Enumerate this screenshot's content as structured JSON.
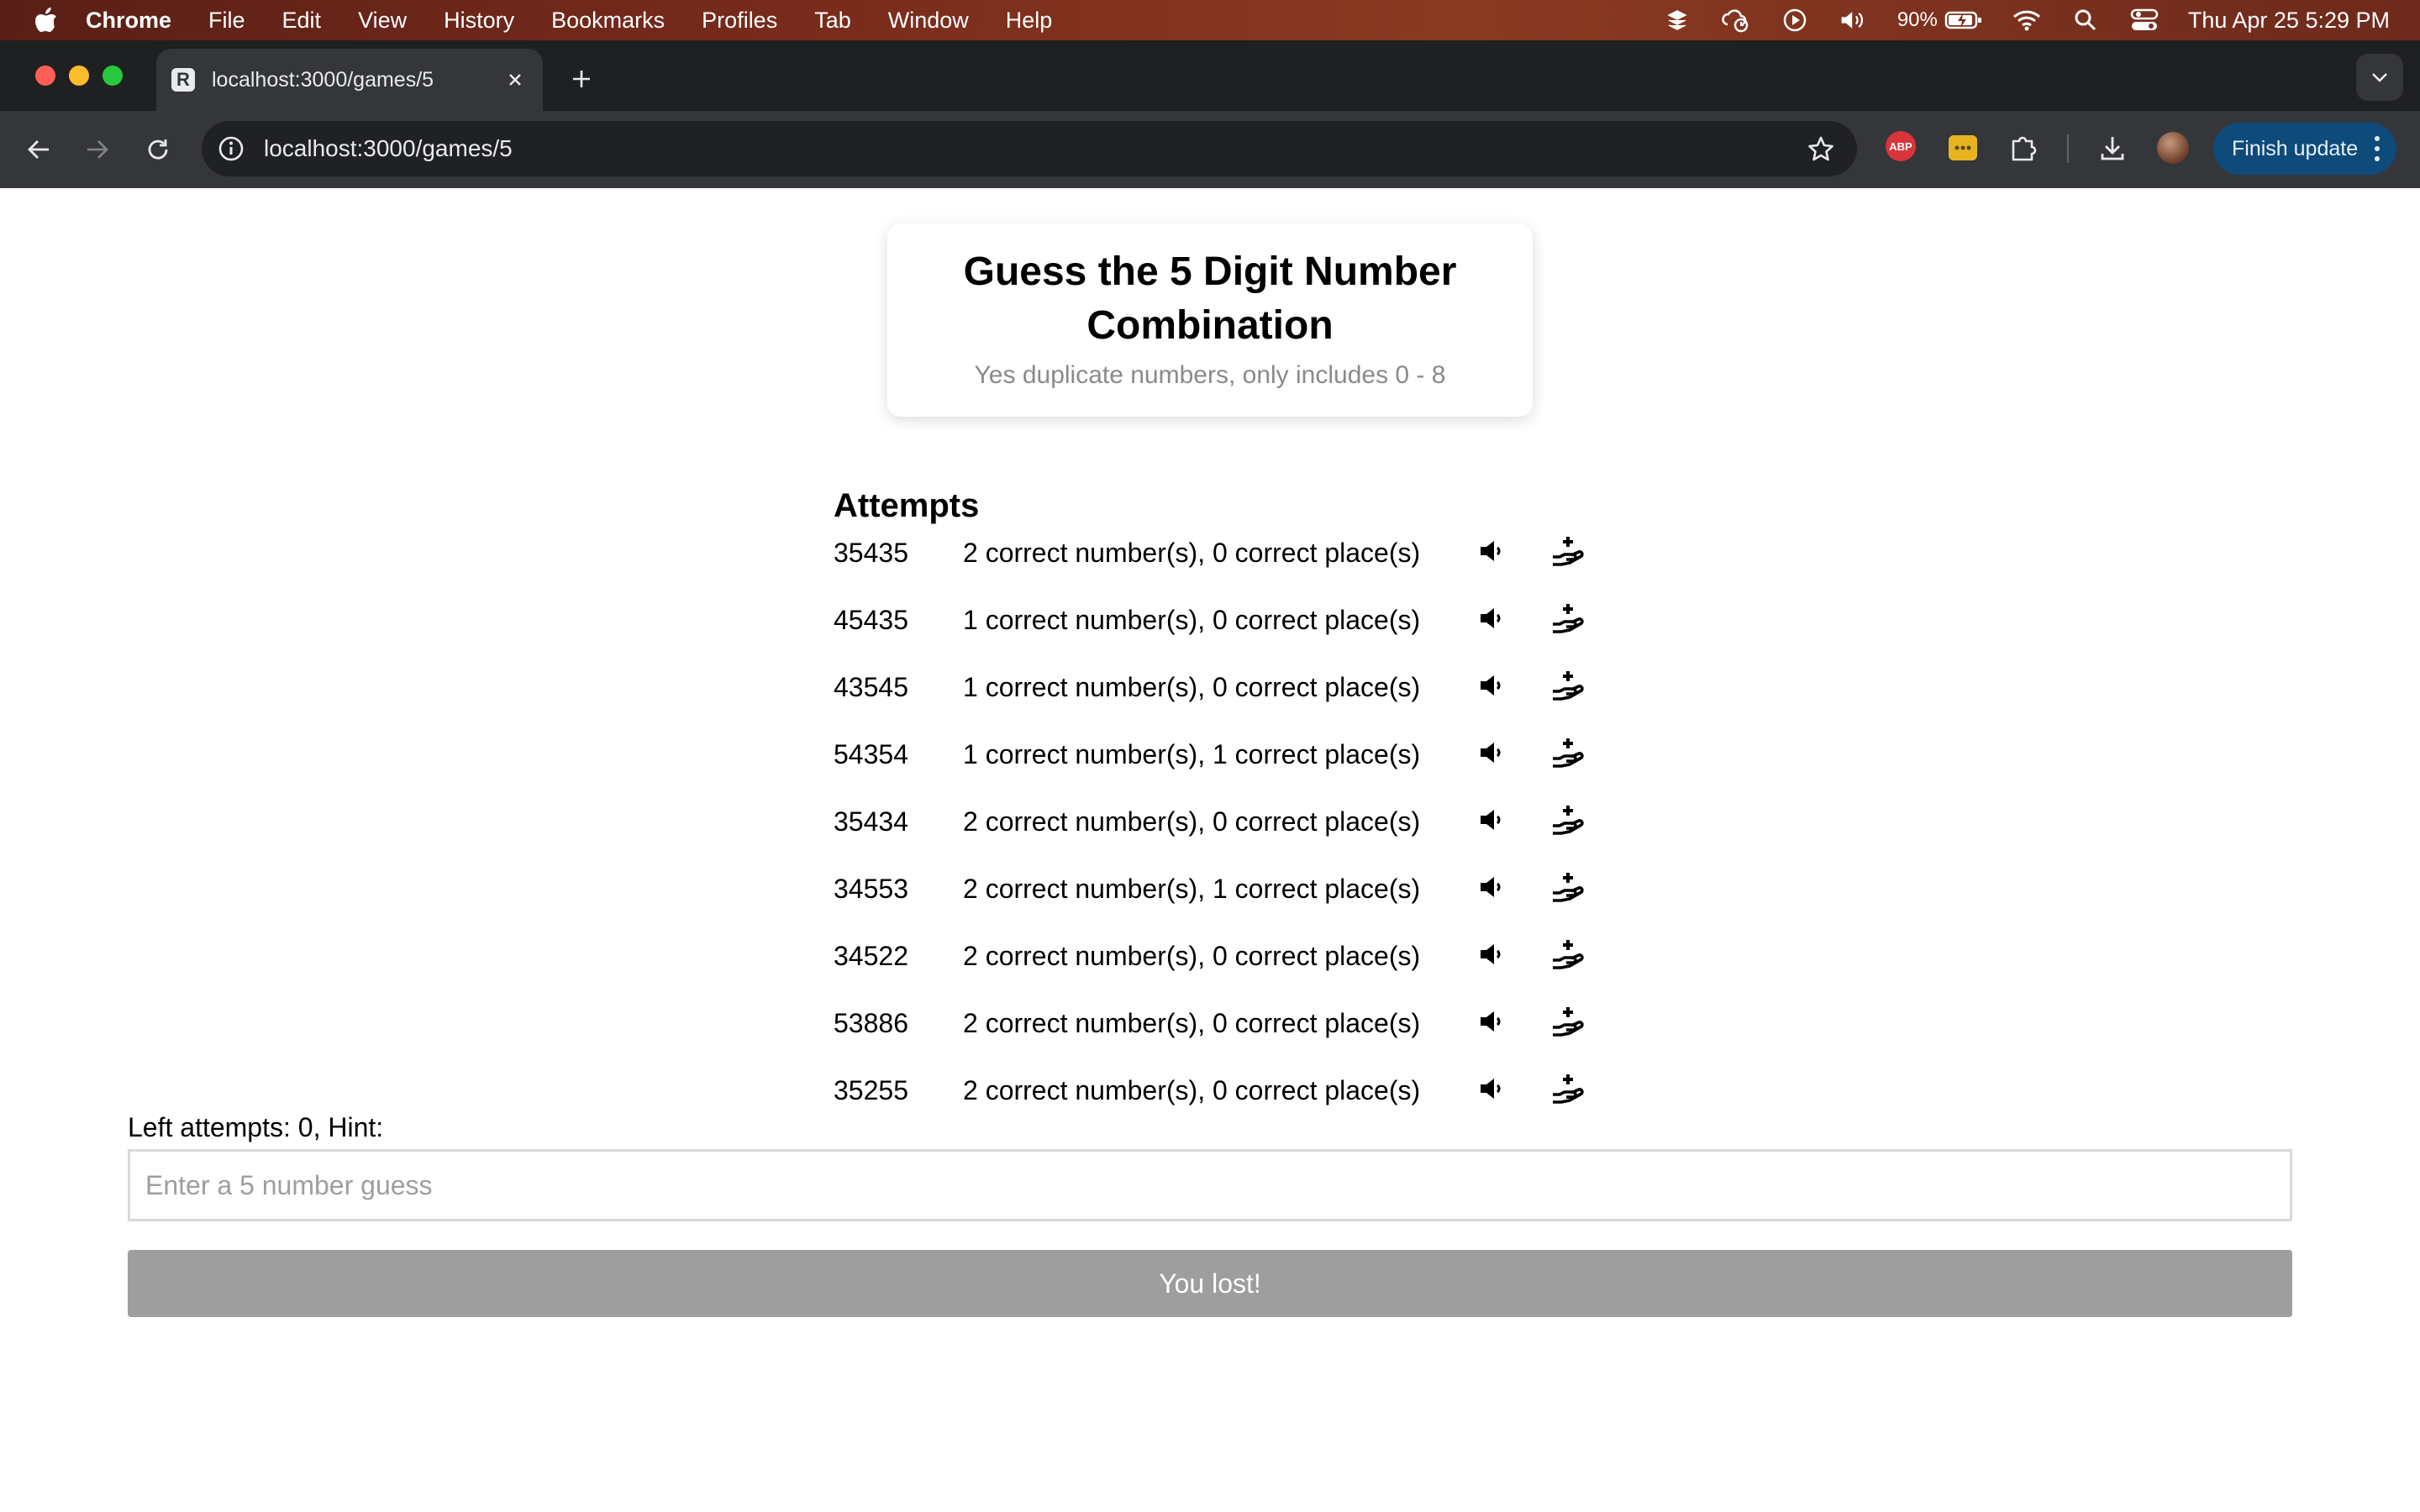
{
  "menubar": {
    "app_name": "Chrome",
    "items": [
      "File",
      "Edit",
      "View",
      "History",
      "Bookmarks",
      "Profiles",
      "Tab",
      "Window",
      "Help"
    ],
    "battery": "90%",
    "clock": "Thu Apr 25  5:29 PM"
  },
  "browser": {
    "tab_title": "localhost:3000/games/5",
    "url": "localhost:3000/games/5",
    "abp_label": "ABP",
    "finish_update_label": "Finish update"
  },
  "game": {
    "title": "Guess the 5 Digit Number Combination",
    "subtitle": "Yes duplicate numbers, only includes 0 - 8",
    "attempts_heading": "Attempts",
    "attempts": [
      {
        "guess": "35435",
        "result": "2 correct number(s), 0 correct place(s)"
      },
      {
        "guess": "45435",
        "result": "1 correct number(s), 0 correct place(s)"
      },
      {
        "guess": "43545",
        "result": "1 correct number(s), 0 correct place(s)"
      },
      {
        "guess": "54354",
        "result": "1 correct number(s), 1 correct place(s)"
      },
      {
        "guess": "35434",
        "result": "2 correct number(s), 0 correct place(s)"
      },
      {
        "guess": "34553",
        "result": "2 correct number(s), 1 correct place(s)"
      },
      {
        "guess": "34522",
        "result": "2 correct number(s), 0 correct place(s)"
      },
      {
        "guess": "53886",
        "result": "2 correct number(s), 0 correct place(s)"
      },
      {
        "guess": "35255",
        "result": "2 correct number(s), 0 correct place(s)"
      }
    ],
    "status_line": "Left attempts: 0, Hint:",
    "input_placeholder": "Enter a 5 number guess",
    "button_label": "You lost!"
  },
  "colors": {
    "button_disabled": "#9e9e9e",
    "finish_update": "#0e4a7a"
  }
}
